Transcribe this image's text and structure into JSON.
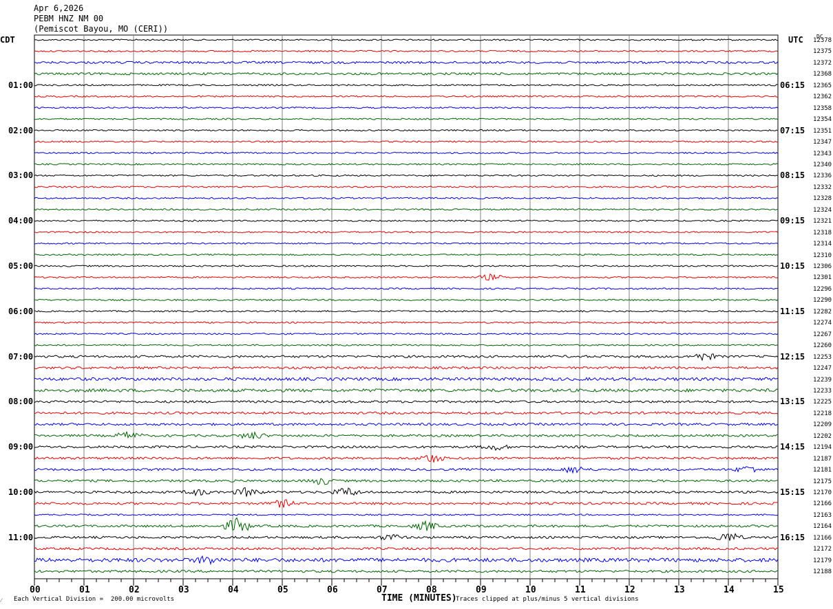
{
  "header": {
    "date": "Apr 6,2026",
    "station": "PEBM HNZ NM 00",
    "location": "(Pemiscot Bayou, MO (CERI))"
  },
  "left_tz": "CDT",
  "right_tz": "UTC",
  "dc_label": "DC",
  "footer": {
    "corner_mark": "⁄",
    "scale": "Each Vertical Division =  200.00 microvolts",
    "clip": "Traces clipped at plus/minus 5 vertical divisions"
  },
  "colors": {
    "trace_cycle": [
      "#000000",
      "#e00000",
      "#0000e0",
      "#006400"
    ],
    "grid": "#808080"
  },
  "chart_data": {
    "type": "line",
    "title": "",
    "xlabel": "TIME (MINUTES)",
    "x_ticks": [
      "00",
      "01",
      "02",
      "03",
      "04",
      "05",
      "06",
      "07",
      "08",
      "09",
      "10",
      "11",
      "12",
      "13",
      "14",
      "15"
    ],
    "xlim": [
      0,
      15
    ],
    "left_hour_labels": [
      "01:00",
      "02:00",
      "03:00",
      "04:00",
      "05:00",
      "06:00",
      "07:00",
      "08:00",
      "09:00",
      "10:00",
      "11:00"
    ],
    "right_hour_labels": [
      "06:15",
      "07:15",
      "08:15",
      "09:15",
      "10:15",
      "11:15",
      "12:15",
      "13:15",
      "14:15",
      "15:15",
      "16:15"
    ],
    "dc_values": [
      "12378",
      "12375",
      "12372",
      "12368",
      "12365",
      "12362",
      "12358",
      "12354",
      "12351",
      "12347",
      "12343",
      "12340",
      "12336",
      "12332",
      "12328",
      "12324",
      "12321",
      "12318",
      "12314",
      "12310",
      "12306",
      "12301",
      "12296",
      "12290",
      "12282",
      "12274",
      "12267",
      "12260",
      "12253",
      "12247",
      "12239",
      "12233",
      "12225",
      "12218",
      "12209",
      "12202",
      "12194",
      "12187",
      "12181",
      "12175",
      "12170",
      "12166",
      "12163",
      "12164",
      "12166",
      "12172",
      "12179",
      "12188"
    ],
    "trace_amplitude": [
      2,
      2,
      3,
      3,
      2,
      2,
      2,
      2,
      2,
      2,
      2,
      2,
      2,
      2,
      2,
      2,
      2,
      2,
      2,
      2,
      2,
      2,
      2,
      2,
      2,
      2,
      2,
      2,
      3,
      3,
      4,
      4,
      3,
      3,
      3,
      3,
      3,
      3,
      3,
      3,
      3,
      3,
      2,
      3,
      3,
      3,
      5,
      3
    ],
    "events": [
      {
        "trace": 21,
        "minute": 9.2,
        "amp": 4
      },
      {
        "trace": 28,
        "minute": 13.5,
        "amp": 5
      },
      {
        "trace": 35,
        "minute": 1.9,
        "amp": 5
      },
      {
        "trace": 35,
        "minute": 4.4,
        "amp": 5
      },
      {
        "trace": 36,
        "minute": 9.3,
        "amp": 4
      },
      {
        "trace": 37,
        "minute": 8.0,
        "amp": 6
      },
      {
        "trace": 38,
        "minute": 10.9,
        "amp": 5
      },
      {
        "trace": 38,
        "minute": 14.4,
        "amp": 5
      },
      {
        "trace": 39,
        "minute": 5.8,
        "amp": 5
      },
      {
        "trace": 40,
        "minute": 3.3,
        "amp": 4
      },
      {
        "trace": 40,
        "minute": 4.3,
        "amp": 6
      },
      {
        "trace": 40,
        "minute": 6.3,
        "amp": 6
      },
      {
        "trace": 41,
        "minute": 5.0,
        "amp": 5
      },
      {
        "trace": 43,
        "minute": 4.1,
        "amp": 11
      },
      {
        "trace": 43,
        "minute": 7.9,
        "amp": 6
      },
      {
        "trace": 44,
        "minute": 7.2,
        "amp": 4
      },
      {
        "trace": 44,
        "minute": 14.0,
        "amp": 7
      },
      {
        "trace": 46,
        "minute": 3.5,
        "amp": 5
      }
    ]
  }
}
